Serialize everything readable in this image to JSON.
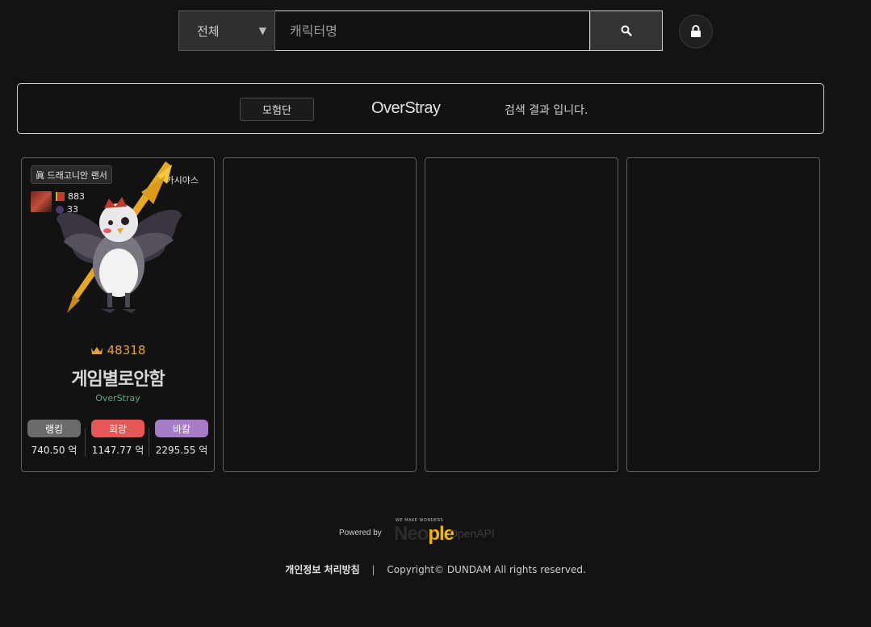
{
  "search": {
    "category_selected": "전체",
    "placeholder": "캐릭터명",
    "value": ""
  },
  "icons": {
    "search": "search-icon",
    "lock": "lock-icon",
    "dropdown": "triangle-down-icon"
  },
  "result_banner": {
    "tag": "모험단",
    "guild_name": "OverStray",
    "message": "검색 결과 입니다."
  },
  "cards": [
    {
      "job": "眞 드래고니안 랜서",
      "server": "카시야스",
      "stat1": "883",
      "stat2": "33",
      "fame": "48318",
      "name": "게임별로안함",
      "guild": "OverStray",
      "scores": [
        {
          "label": "랭킹",
          "value": "740.50 억",
          "color": "#6b6b6b"
        },
        {
          "label": "회랑",
          "value": "1147.77 억",
          "color": "#e65757"
        },
        {
          "label": "바칼",
          "value": "2295.55 억",
          "color": "#a67cc7"
        }
      ]
    }
  ],
  "empty_card_count": 3,
  "footer": {
    "powered_by": "Powered by",
    "logo_small": "WE MAKE WONDERS",
    "logo_text_pre": "Neo",
    "logo_text_accent": "ple",
    "openapi": "OpenAPI",
    "privacy": "개인정보 처리방침",
    "separator": "|",
    "copyright": "Copyright© DUNDAM All rights reserved."
  },
  "colors": {
    "background": "#131313",
    "fame": "#e6a23c",
    "guild_green": "#5faa7f",
    "logo_accent": "#f0b400"
  }
}
